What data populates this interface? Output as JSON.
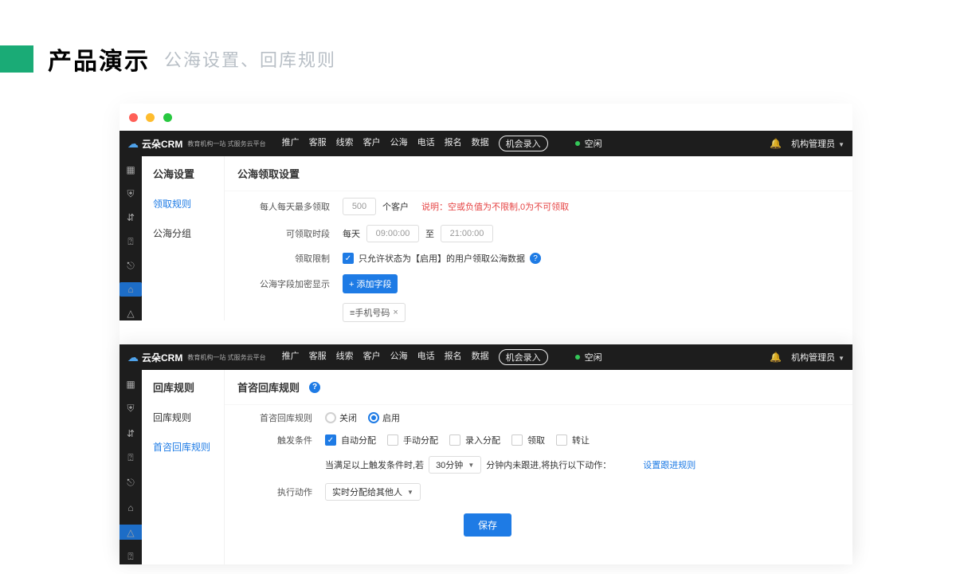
{
  "heading": {
    "main": "产品演示",
    "sub": "公海设置、回库规则"
  },
  "logo": {
    "brand": "云朵CRM",
    "tagline": "教育机构一站\n式服务云平台"
  },
  "nav": [
    "推广",
    "客服",
    "线索",
    "客户",
    "公海",
    "电话",
    "报名",
    "数据"
  ],
  "nav_pill": "机会录入",
  "status": "空闲",
  "user": "机构管理员",
  "panelA": {
    "side_title": "公海设置",
    "side_items": [
      "领取规则",
      "公海分组"
    ],
    "side_sel": 0,
    "content_title": "公海领取设置",
    "row1": {
      "label": "每人每天最多领取",
      "value": "500",
      "unit": "个客户",
      "hint_pre": "说明：",
      "hint": "空或负值为不限制,0为不可领取"
    },
    "row2": {
      "label": "可领取时段",
      "daily": "每天",
      "from": "09:00:00",
      "to_lbl": "至",
      "to": "21:00:00"
    },
    "row3": {
      "label": "领取限制",
      "text": "只允许状态为【启用】的用户领取公海数据"
    },
    "row4": {
      "label": "公海字段加密显示",
      "btn": "+ 添加字段"
    },
    "tag": "≡手机号码"
  },
  "panelB": {
    "side_title": "回库规则",
    "side_items": [
      "回库规则",
      "首咨回库规则"
    ],
    "side_sel": 1,
    "content_title": "首咨回库规则",
    "row1": {
      "label": "首咨回库规则",
      "off": "关闭",
      "on": "启用"
    },
    "row2": {
      "label": "触发条件",
      "items": [
        "自动分配",
        "手动分配",
        "录入分配",
        "领取",
        "转让"
      ],
      "checked": [
        true,
        false,
        false,
        false,
        false
      ]
    },
    "row3": {
      "pre": "当满足以上触发条件时,若",
      "sel": "30分钟",
      "post": "分钟内未跟进,将执行以下动作：",
      "link": "设置跟进规则"
    },
    "row4": {
      "label": "执行动作",
      "sel": "实时分配给其他人"
    },
    "save": "保存"
  }
}
